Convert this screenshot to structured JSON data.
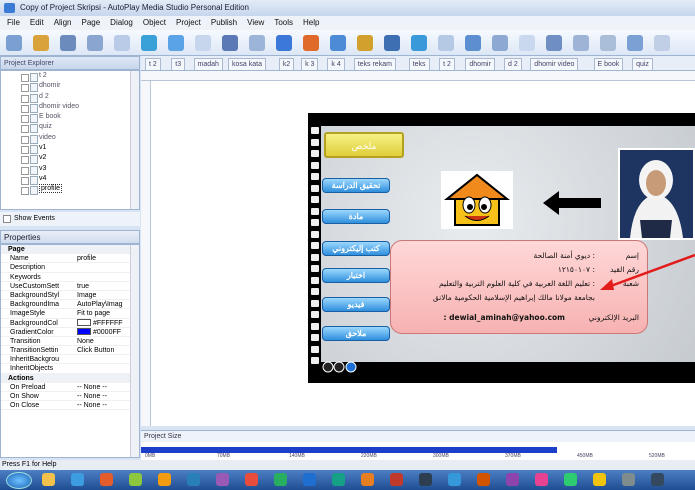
{
  "window": {
    "title": "Copy of Project Skripsi - AutoPlay Media Studio Personal Edition"
  },
  "menu": [
    "File",
    "Edit",
    "Align",
    "Page",
    "Dialog",
    "Object",
    "Project",
    "Publish",
    "View",
    "Tools",
    "Help"
  ],
  "explorer": {
    "title": "Project Explorer",
    "items": [
      "t 2",
      "dhomir",
      "d 2",
      "dhomir video",
      "E book",
      "quiz",
      "video",
      "v1",
      "v2",
      "v3",
      "v4",
      "profile"
    ],
    "show_events": "Show Events"
  },
  "page_tabs": [
    "t 2",
    "t3",
    "madah",
    "kosa kata",
    "k2",
    "k 3",
    "k 4",
    "teks rekam",
    "teks",
    "t 2",
    "dhomir",
    "d 2",
    "dhomir video",
    "E book",
    "quiz"
  ],
  "properties": {
    "title": "Properties",
    "rows": [
      {
        "k": "Page",
        "v": "",
        "section": true
      },
      {
        "k": "Name",
        "v": "profile"
      },
      {
        "k": "Description",
        "v": ""
      },
      {
        "k": "Keywords",
        "v": ""
      },
      {
        "k": "UseCustomSett",
        "v": "true"
      },
      {
        "k": "BackgroundStyl",
        "v": "Image"
      },
      {
        "k": "BackgroundIma",
        "v": "AutoPlay\\Imag"
      },
      {
        "k": "ImageStyle",
        "v": "Fit to page"
      },
      {
        "k": "BackgroundCol",
        "v": "#FFFFFF"
      },
      {
        "k": "GradientColor",
        "v": "#0000FF"
      },
      {
        "k": "Transition",
        "v": "None"
      },
      {
        "k": "TransitionSettin",
        "v": "Click Button"
      },
      {
        "k": "InheritBackgrou",
        "v": ""
      },
      {
        "k": "InheritObjects",
        "v": ""
      },
      {
        "k": "Actions",
        "v": "",
        "section": true
      },
      {
        "k": "On Preload",
        "v": "-- None --"
      },
      {
        "k": "On Show",
        "v": "-- None --"
      },
      {
        "k": "On Close",
        "v": "-- None --"
      }
    ]
  },
  "slide": {
    "top_button": "ملخص",
    "nav": [
      "تحقيق الدراسة",
      "مادة",
      "كتب إليكتروني",
      "اختبار",
      "فيديو",
      "ملاحق"
    ],
    "info_lines": [
      {
        "label": "إسم",
        "value": ": ديوي أمنة الصالحة"
      },
      {
        "label": "رقم القيد",
        "value": ": ١٢١٥٠١٠٧"
      },
      {
        "label": "شعبة",
        "value": ": تعليم اللغة العربية في كلية العلوم التربية والتعليم"
      },
      {
        "label": "",
        "value": "بجامعة مولانا مالك إبراهيم الإسلامية الحكومية مالانق"
      },
      {
        "label": "البريد الإلكتروني",
        "value": ": dewial_aminah@yahoo.com"
      }
    ]
  },
  "project_size": {
    "title": "Project Size",
    "fill_fraction": 0.75,
    "ticks": [
      "0MB",
      "70MB",
      "140MB",
      "220MB",
      "300MB",
      "370MB",
      "450MB",
      "520MB"
    ]
  },
  "status": {
    "text": "Press F1 for Help"
  },
  "colors": {
    "swatch_bg": "#FFFFFF",
    "swatch_grad": "#0000FF",
    "accent": "#1b3fc9"
  }
}
